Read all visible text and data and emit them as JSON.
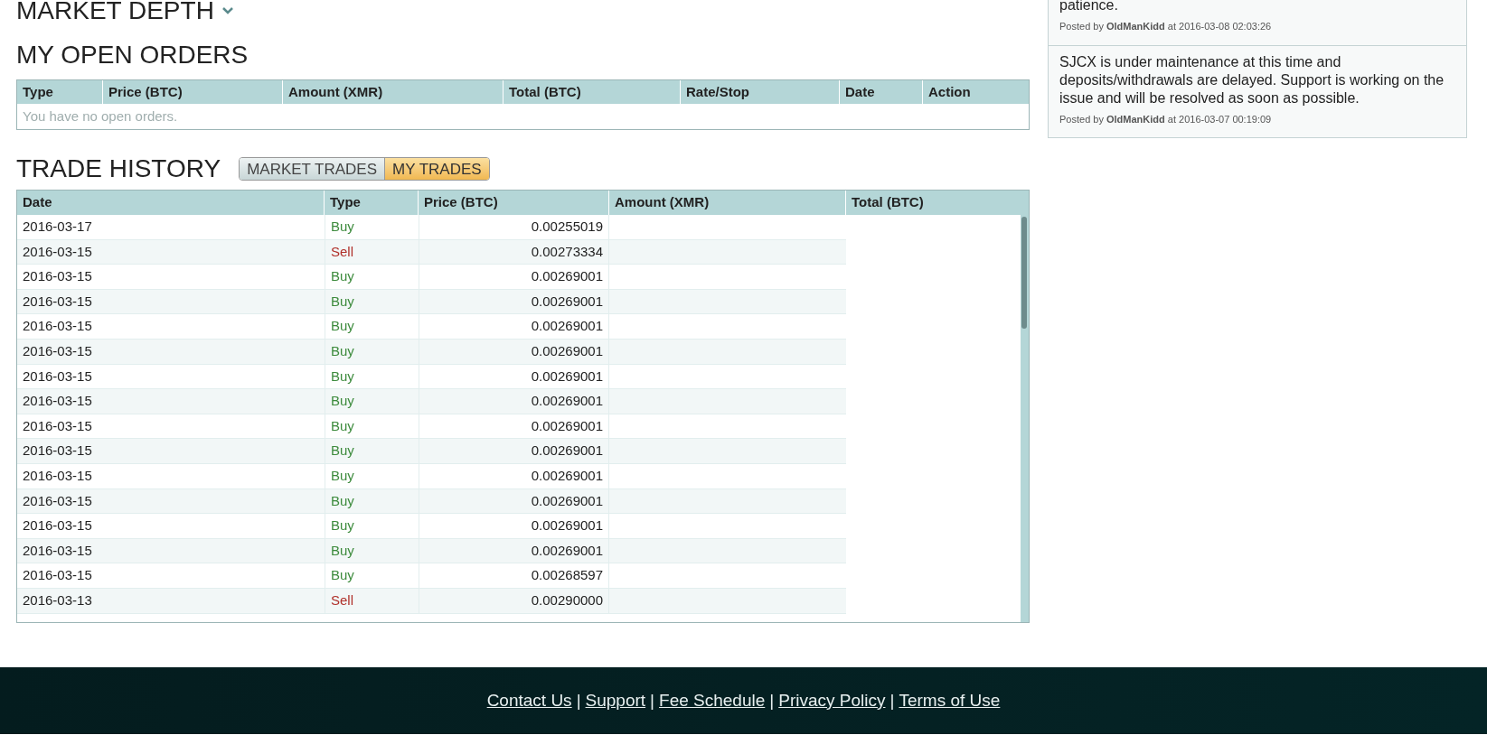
{
  "market_depth": {
    "title": "MARKET DEPTH"
  },
  "open_orders": {
    "title": "MY OPEN ORDERS",
    "columns": [
      "Type",
      "Price (BTC)",
      "Amount (XMR)",
      "Total (BTC)",
      "Rate/Stop",
      "Date",
      "Action"
    ],
    "empty_message": "You have no open orders."
  },
  "trade_history": {
    "title": "TRADE HISTORY",
    "tabs": [
      {
        "label": "MARKET TRADES",
        "selected": false
      },
      {
        "label": "MY TRADES",
        "selected": true
      }
    ],
    "columns": [
      "Date",
      "Type",
      "Price (BTC)",
      "Amount (XMR)",
      "Total (BTC)"
    ],
    "rows": [
      {
        "date": "2016-03-17",
        "type": "Buy",
        "price": "0.00255019"
      },
      {
        "date": "2016-03-15",
        "type": "Sell",
        "price": "0.00273334"
      },
      {
        "date": "2016-03-15",
        "type": "Buy",
        "price": "0.00269001"
      },
      {
        "date": "2016-03-15",
        "type": "Buy",
        "price": "0.00269001"
      },
      {
        "date": "2016-03-15",
        "type": "Buy",
        "price": "0.00269001"
      },
      {
        "date": "2016-03-15",
        "type": "Buy",
        "price": "0.00269001"
      },
      {
        "date": "2016-03-15",
        "type": "Buy",
        "price": "0.00269001"
      },
      {
        "date": "2016-03-15",
        "type": "Buy",
        "price": "0.00269001"
      },
      {
        "date": "2016-03-15",
        "type": "Buy",
        "price": "0.00269001"
      },
      {
        "date": "2016-03-15",
        "type": "Buy",
        "price": "0.00269001"
      },
      {
        "date": "2016-03-15",
        "type": "Buy",
        "price": "0.00269001"
      },
      {
        "date": "2016-03-15",
        "type": "Buy",
        "price": "0.00269001"
      },
      {
        "date": "2016-03-15",
        "type": "Buy",
        "price": "0.00269001"
      },
      {
        "date": "2016-03-15",
        "type": "Buy",
        "price": "0.00269001"
      },
      {
        "date": "2016-03-15",
        "type": "Buy",
        "price": "0.00268597"
      },
      {
        "date": "2016-03-13",
        "type": "Sell",
        "price": "0.00290000"
      }
    ]
  },
  "announcements": [
    {
      "text": "patience.",
      "posted": "Posted by **OldManKidd** at 2016-03-08 02:03:26"
    },
    {
      "text": "SJCX is under maintenance at this time and deposits/withdrawals are delayed. Support is working on the issue and will be resolved as soon as possible.",
      "posted": "Posted by **OldManKidd** at 2016-03-07 00:19:09"
    }
  ],
  "footer": {
    "links": [
      "Contact Us",
      "Support",
      "Fee Schedule",
      "Privacy Policy",
      "Terms of Use"
    ],
    "separator": "|"
  }
}
